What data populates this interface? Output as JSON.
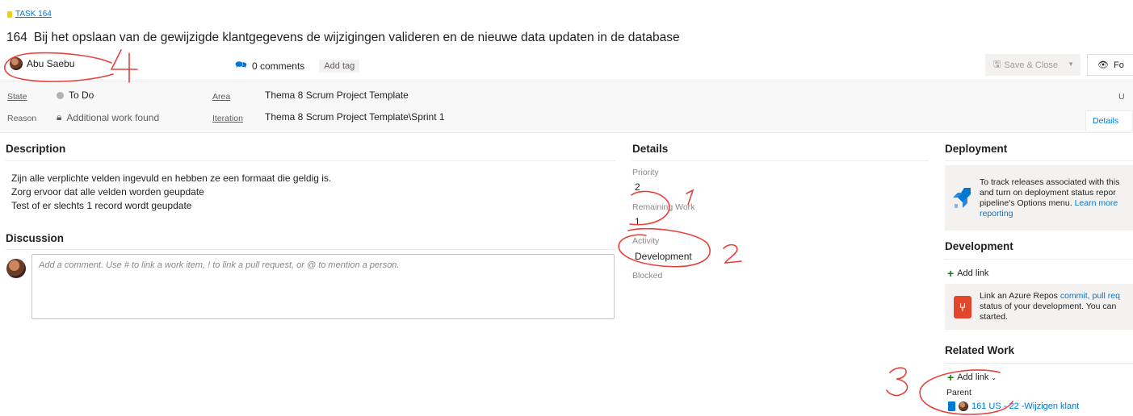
{
  "header": {
    "task_link": "TASK 164",
    "id": "164",
    "title": "Bij het opslaan van de gewijzigde klantgegevens de wijzigingen valideren en de nieuwe data updaten in de database",
    "assignee": "Abu Saebu",
    "comments": "0 comments",
    "add_tag": "Add tag",
    "save_close": "Save & Close",
    "follow": "Fo"
  },
  "statebar": {
    "state_label": "State",
    "state_value": "To Do",
    "reason_label": "Reason",
    "reason_value": "Additional work found",
    "area_label": "Area",
    "area_value": "Thema 8 Scrum Project Template",
    "iteration_label": "Iteration",
    "iteration_value": "Thema 8 Scrum Project Template\\Sprint 1",
    "right_letter": "U",
    "details_tab": "Details"
  },
  "description": {
    "heading": "Description",
    "lines": [
      "Zijn alle verplichte velden ingevuld en hebben ze een formaat die geldig is.",
      "Zorg ervoor dat alle velden worden geupdate",
      "Test of er slechts 1 record wordt geupdate"
    ]
  },
  "discussion": {
    "heading": "Discussion",
    "placeholder": "Add a comment. Use # to link a work item, ! to link a pull request, or @ to mention a person."
  },
  "details": {
    "heading": "Details",
    "priority_label": "Priority",
    "priority_value": "2",
    "remaining_label": "Remaining Work",
    "remaining_value": "1",
    "activity_label": "Activity",
    "activity_value": "Development",
    "blocked_label": "Blocked"
  },
  "deployment": {
    "heading": "Deployment",
    "text1": "To track releases associated with this",
    "text2": "and turn on deployment status repor",
    "text3_pre": "pipeline's Options menu.",
    "text3_link": "Learn more",
    "text4_link": "reporting"
  },
  "development": {
    "heading": "Development",
    "add_link": "Add link",
    "text1_pre": "Link an Azure Repos",
    "text1_link": "commit, pull req",
    "text2": "status of your development. You can",
    "text3": "started."
  },
  "related_work": {
    "heading": "Related Work",
    "add_link": "Add link",
    "parent_label": "Parent",
    "parent_item": "161 US - 22 -Wijzigen klant"
  },
  "annotations": {
    "num1": "1",
    "num2": "2",
    "num3": "3",
    "num4": "4",
    "color": "#e8413c"
  },
  "colors": {
    "accent": "#0078d4",
    "task_yellow": "#f2cb1d",
    "state_gray": "#b2b2b2",
    "annotation_red": "#e8413c"
  }
}
